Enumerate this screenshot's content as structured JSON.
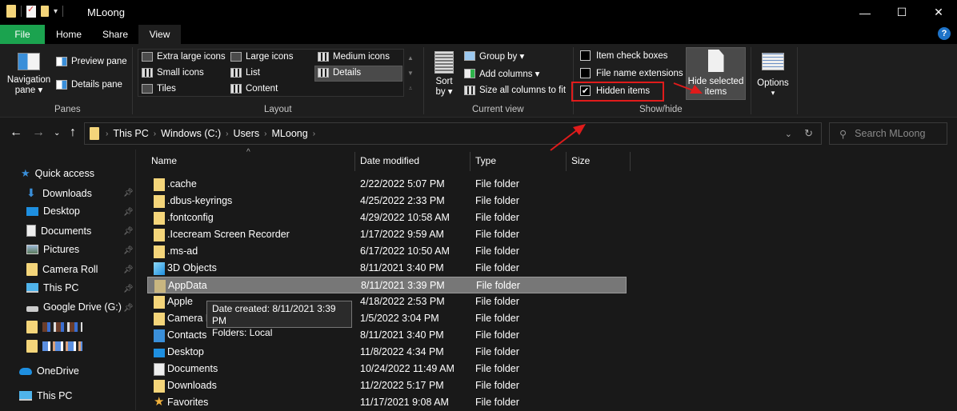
{
  "window": {
    "title": "MLoong",
    "controls": {
      "minimize": "—",
      "maximize": "☐",
      "close": "✕"
    }
  },
  "ribbon_tabs": [
    {
      "label": "File",
      "active": false,
      "color": "#1ba34f"
    },
    {
      "label": "Home",
      "active": false
    },
    {
      "label": "Share",
      "active": false
    },
    {
      "label": "View",
      "active": true
    }
  ],
  "ribbon": {
    "help": "?",
    "collapse": "^",
    "panes": {
      "label": "Panes",
      "navigation_pane": "Navigation pane",
      "navigation_pane_line1": "Navigation",
      "navigation_pane_line2": "pane ▾",
      "preview_pane": "Preview pane",
      "details_pane": "Details pane"
    },
    "layout": {
      "label": "Layout",
      "options": [
        "Extra large icons",
        "Large icons",
        "Medium icons",
        "Small icons",
        "List",
        "Details",
        "Tiles",
        "Content"
      ],
      "selected": "Details"
    },
    "current_view": {
      "label": "Current view",
      "sort_line1": "Sort",
      "sort_line2": "by ▾",
      "group_by": "Group by ▾",
      "add_columns": "Add columns ▾",
      "size_columns": "Size all columns to fit"
    },
    "show_hide": {
      "label": "Show/hide",
      "item_check_boxes": {
        "label": "Item check boxes",
        "checked": false
      },
      "file_name_extensions": {
        "label": "File name extensions",
        "checked": false
      },
      "hidden_items": {
        "label": "Hidden items",
        "checked": true
      },
      "hide_selected_line1": "Hide selected",
      "hide_selected_line2": "items"
    },
    "options": {
      "label": "Options",
      "arrow": "▾"
    }
  },
  "address": {
    "breadcrumbs": [
      "This PC",
      "Windows (C:)",
      "Users",
      "MLoong"
    ],
    "search_placeholder": "Search MLoong"
  },
  "sidebar": {
    "quick_access": "Quick access",
    "items": [
      {
        "label": "Downloads",
        "icon": "download-arrow-icon",
        "pinned": true
      },
      {
        "label": "Desktop",
        "icon": "desktop-icon",
        "pinned": true
      },
      {
        "label": "Documents",
        "icon": "documents-icon",
        "pinned": true
      },
      {
        "label": "Pictures",
        "icon": "pictures-icon",
        "pinned": true
      },
      {
        "label": "Camera Roll",
        "icon": "folder-icon",
        "pinned": true
      },
      {
        "label": "This PC",
        "icon": "computer-icon",
        "pinned": true
      },
      {
        "label": "Google Drive (G:)",
        "icon": "drive-icon",
        "pinned": true
      }
    ],
    "onedrive": "OneDrive",
    "this_pc": "This PC"
  },
  "columns": [
    "Name",
    "Date modified",
    "Type",
    "Size"
  ],
  "files": [
    {
      "name": ".cache",
      "date": "2/22/2022 5:07 PM",
      "type": "File folder",
      "icon": "folder"
    },
    {
      "name": ".dbus-keyrings",
      "date": "4/25/2022 2:33 PM",
      "type": "File folder",
      "icon": "folder"
    },
    {
      "name": ".fontconfig",
      "date": "4/29/2022 10:58 AM",
      "type": "File folder",
      "icon": "folder"
    },
    {
      "name": ".Icecream Screen Recorder",
      "date": "1/17/2022 9:59 AM",
      "type": "File folder",
      "icon": "folder"
    },
    {
      "name": ".ms-ad",
      "date": "6/17/2022 10:50 AM",
      "type": "File folder",
      "icon": "folder"
    },
    {
      "name": "3D Objects",
      "date": "8/11/2021 3:40 PM",
      "type": "File folder",
      "icon": "3d"
    },
    {
      "name": "AppData",
      "date": "8/11/2021 3:39 PM",
      "type": "File folder",
      "icon": "folder-faded",
      "selected": true
    },
    {
      "name": "Apple",
      "date": "4/18/2022 2:53 PM",
      "type": "File folder",
      "icon": "folder"
    },
    {
      "name": "Camera Roll",
      "date": "1/5/2022 3:04 PM",
      "type": "File folder",
      "icon": "folder"
    },
    {
      "name": "Contacts",
      "date": "8/11/2021 3:40 PM",
      "type": "File folder",
      "icon": "contacts"
    },
    {
      "name": "Desktop",
      "date": "11/8/2022 4:34 PM",
      "type": "File folder",
      "icon": "desktop"
    },
    {
      "name": "Documents",
      "date": "10/24/2022 11:49 AM",
      "type": "File folder",
      "icon": "documents"
    },
    {
      "name": "Downloads",
      "date": "11/2/2022 5:17 PM",
      "type": "File folder",
      "icon": "folder"
    },
    {
      "name": "Favorites",
      "date": "11/17/2021 9:08 AM",
      "type": "File folder",
      "icon": "star"
    }
  ],
  "tooltip": {
    "line1": "Date created: 8/11/2021 3:39 PM",
    "line2": "Folders: Local"
  },
  "annotation_color": "#e01b1b"
}
